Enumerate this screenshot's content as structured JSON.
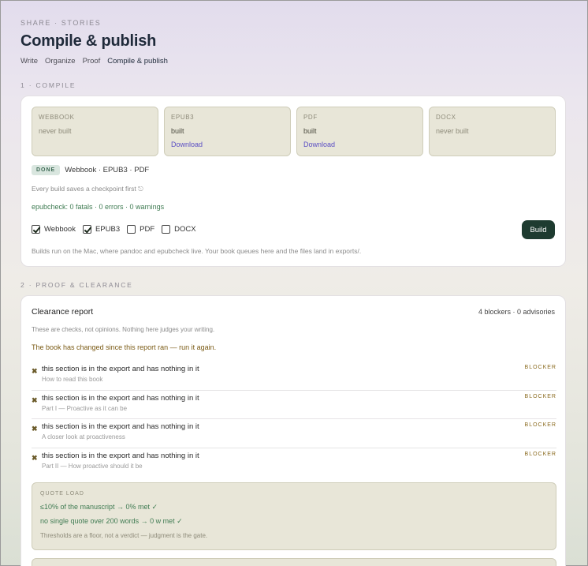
{
  "header": {
    "kicker": "SHARE · STORIES",
    "title": "Compile & publish",
    "nav": [
      "Write",
      "Organize",
      "Proof",
      "Compile & publish"
    ]
  },
  "compile": {
    "label": "1 · COMPILE",
    "formats": [
      {
        "name": "WEBBOOK",
        "status": "never built",
        "download": ""
      },
      {
        "name": "EPUB3",
        "status": "built",
        "download": "Download"
      },
      {
        "name": "PDF",
        "status": "built",
        "download": "Download"
      },
      {
        "name": "DOCX",
        "status": "never built",
        "download": ""
      }
    ],
    "status_badge": "DONE",
    "status_text": "Webbook · EPUB3 · PDF",
    "checkpoint_note": "Every build saves a checkpoint first ⎋",
    "epubcheck": "epubcheck: 0 fatals · 0 errors · 0 warnings",
    "options": [
      {
        "label": "Webbook",
        "checked": true
      },
      {
        "label": "EPUB3",
        "checked": true
      },
      {
        "label": "PDF",
        "checked": false
      },
      {
        "label": "DOCX",
        "checked": false
      }
    ],
    "build_label": "Build",
    "footnote": "Builds run on the Mac, where pandoc and epubcheck live. Your book queues here and the files land in exports/."
  },
  "proof": {
    "label": "2 · PROOF & CLEARANCE",
    "report_title": "Clearance report",
    "counts": "4 blockers · 0 advisories",
    "subtitle": "These are checks, not opinions. Nothing here judges your writing.",
    "warning": "The book has changed since this report ran — run it again.",
    "issues": [
      {
        "text": "this section is in the export and has nothing in it",
        "section": "How to read this book",
        "tag": "BLOCKER"
      },
      {
        "text": "this section is in the export and has nothing in it",
        "section": "Part I — Proactive as it can be",
        "tag": "BLOCKER"
      },
      {
        "text": "this section is in the export and has nothing in it",
        "section": "A closer look at proactiveness",
        "tag": "BLOCKER"
      },
      {
        "text": "this section is in the export and has nothing in it",
        "section": "Part II — How proactive should it be",
        "tag": "BLOCKER"
      }
    ],
    "quote_load": {
      "heading": "QUOTE LOAD",
      "line1": "≤10% of the manuscript → 0% met ✓",
      "line2": "no single quote over 200 words → 0 w met ✓",
      "note": "Thresholds are a floor, not a verdict — judgment is the gate."
    }
  }
}
